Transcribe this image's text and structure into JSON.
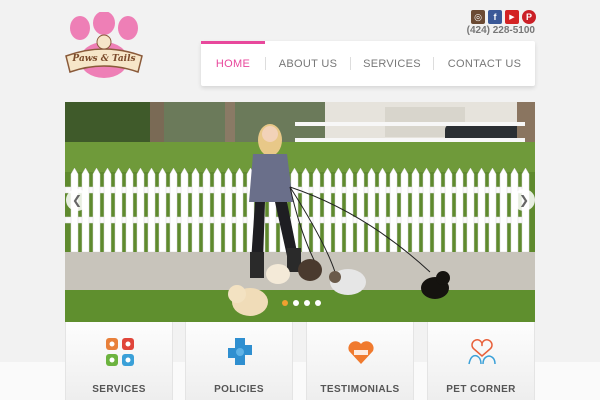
{
  "brand": {
    "name": "Paws & Tails",
    "logo_text": "Paws & Tails"
  },
  "contact": {
    "phone": "(424) 228-5100",
    "social": [
      {
        "name": "instagram-icon",
        "color": "#6b4a33",
        "glyph": "◎"
      },
      {
        "name": "facebook-icon",
        "color": "#3b5998",
        "glyph": "f"
      },
      {
        "name": "youtube-icon",
        "color": "#d32323",
        "glyph": "▶"
      },
      {
        "name": "pinterest-icon",
        "color": "#cb2027",
        "glyph": "P"
      }
    ]
  },
  "nav": {
    "items": [
      {
        "label": "HOME",
        "active": true
      },
      {
        "label": "ABOUT US",
        "active": false
      },
      {
        "label": "SERVICES",
        "active": false
      },
      {
        "label": "CONTACT US",
        "active": false
      }
    ],
    "accent": "#e8489c"
  },
  "slider": {
    "slide_count": 4,
    "active_index": 0,
    "prev_glyph": "❮",
    "next_glyph": "❯"
  },
  "features": [
    {
      "label": "SERVICES",
      "icon": "paw-tiles-icon"
    },
    {
      "label": "POLICIES",
      "icon": "puzzle-piece-icon"
    },
    {
      "label": "TESTIMONIALS",
      "icon": "heart-chat-icon"
    },
    {
      "label": "PET CORNER",
      "icon": "dog-cat-heart-icon"
    }
  ]
}
